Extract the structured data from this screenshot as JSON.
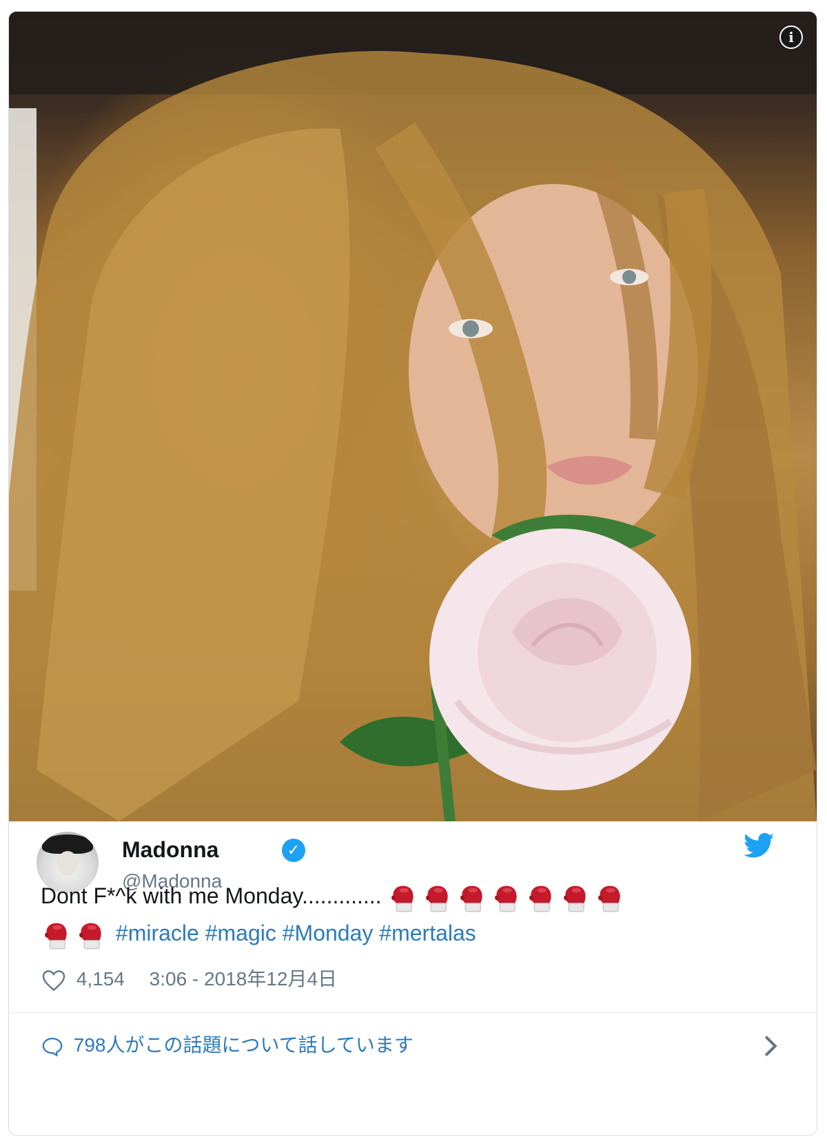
{
  "media": {
    "description_alt": "",
    "info_icon": "info-icon"
  },
  "author": {
    "name": "Madonna",
    "handle": "@Madonna",
    "verified": true,
    "avatar_icon": "avatar"
  },
  "tweet": {
    "text": "Dont F*^k with me Monday.............",
    "emoji_count": 9,
    "emoji_icon": "boxing-glove-icon",
    "hashtags": [
      "#miracle",
      "#magic",
      "#Monday",
      "#mertalas"
    ]
  },
  "meta": {
    "likes": "4,154",
    "timestamp": "3:06 - 2018年12月4日"
  },
  "footer": {
    "talk_text": "798人がこの話題について話しています"
  },
  "colors": {
    "link": "#2b7bb9",
    "twitter_blue": "#1da1f2",
    "text": "#14171a",
    "secondary": "#657786",
    "glove_red": "#c41a2b"
  }
}
